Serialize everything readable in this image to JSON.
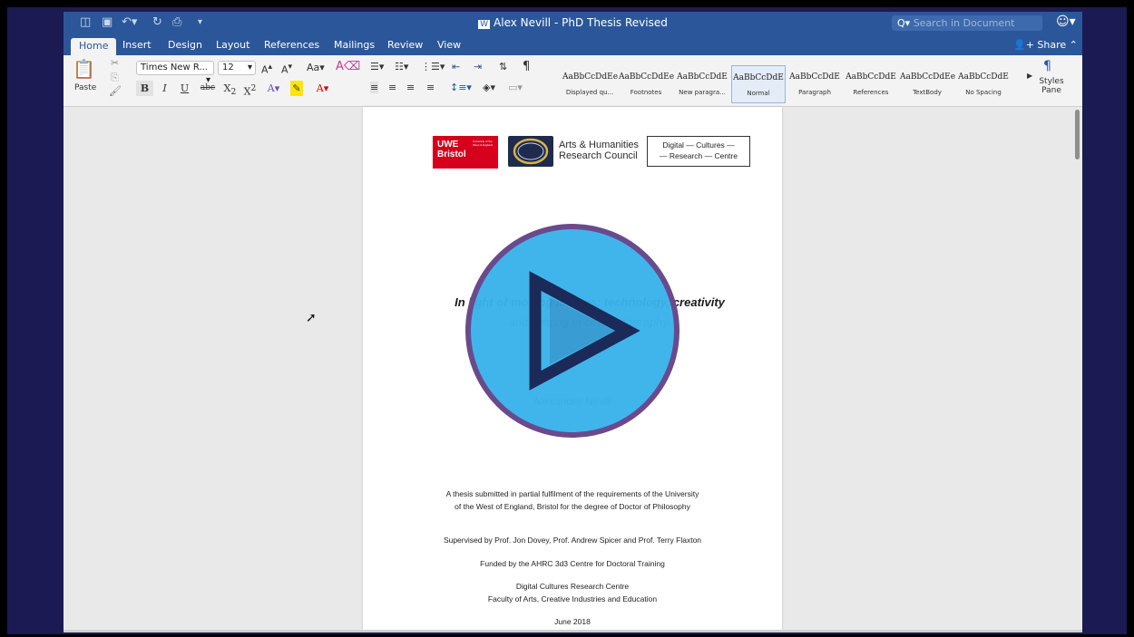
{
  "window": {
    "title": "Alex Nevill - PhD Thesis Revised",
    "search_placeholder": "Search in Document"
  },
  "tabs": [
    "Home",
    "Insert",
    "Design",
    "Layout",
    "References",
    "Mailings",
    "Review",
    "View"
  ],
  "active_tab": "Home",
  "share_label": "Share",
  "ribbon": {
    "paste_label": "Paste",
    "font_name": "Times New R...",
    "font_size": "12",
    "styles_pane_label": "Styles Pane",
    "styles": [
      {
        "sample": "AaBbCcDdEe",
        "name": "Displayed qu..."
      },
      {
        "sample": "AaBbCcDdEe",
        "name": "Footnotes"
      },
      {
        "sample": "AaBbCcDdE",
        "name": "New paragra..."
      },
      {
        "sample": "AaBbCcDdE",
        "name": "Normal",
        "selected": true
      },
      {
        "sample": "AaBbCcDdE",
        "name": "Paragraph"
      },
      {
        "sample": "AaBbCcDdE",
        "name": "References"
      },
      {
        "sample": "AaBbCcDdEe",
        "name": "TextBody"
      },
      {
        "sample": "AaBbCcDdE",
        "name": "No Spacing"
      }
    ]
  },
  "document": {
    "logo_uwe_line1": "UWE",
    "logo_uwe_line2": "Bristol",
    "logo_uwe_small": "University of the West of England",
    "logo_ahrc_line1": "Arts & Humanities",
    "logo_ahrc_line2": "Research Council",
    "logo_dcrc_line1": "Digital — Cultures —",
    "logo_dcrc_line2": "— Research — Centre",
    "title_line1": "In light of moving images: technology, creativity",
    "title_line2": "and lighting in cinematography.",
    "author": "Alexander Nevill",
    "submission_line1": "A thesis submitted in partial fulfilment of the requirements of the University",
    "submission_line2": "of the West of England, Bristol for the degree of Doctor of Philosophy",
    "supervisors": "Supervised by Prof. Jon Dovey, Prof. Andrew Spicer and Prof. Terry Flaxton",
    "funding": "Funded by the AHRC 3d3 Centre for Doctoral Training",
    "centre_line1": "Digital Cultures Research Centre",
    "centre_line2": "Faculty of Arts, Creative Industries and Education",
    "date": "June 2018"
  },
  "colors": {
    "word_blue": "#2b579a",
    "play_fill": "#3ab3ea",
    "play_ring": "#6a4a8c",
    "play_triangle": "#1b2a58",
    "uwe_red": "#d6001c"
  }
}
